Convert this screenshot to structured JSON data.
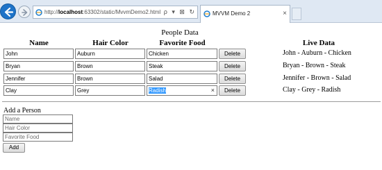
{
  "browser": {
    "url_prefix": "http://",
    "url_host": "localhost",
    "url_rest": ":63302/static/MvvmDemo2.html",
    "address_buttons": "ρ ▾ ⊠ ↻",
    "tab_title": "MVVM Demo 2",
    "tab_close": "×"
  },
  "page": {
    "title": "People Data",
    "headers": {
      "name": "Name",
      "hair": "Hair Color",
      "food": "Favorite Food",
      "live": "Live Data"
    },
    "rows": [
      {
        "name": "John",
        "hair": "Auburn",
        "food": "Chicken",
        "delete": "Delete",
        "live": "John - Auburn - Chicken"
      },
      {
        "name": "Bryan",
        "hair": "Brown",
        "food": "Steak",
        "delete": "Delete",
        "live": "Bryan - Brown - Steak"
      },
      {
        "name": "Jennifer",
        "hair": "Brown",
        "food": "Salad",
        "delete": "Delete",
        "live": "Jennifer - Brown - Salad"
      },
      {
        "name": "Clay",
        "hair": "Grey",
        "food": "Radish",
        "delete": "Delete",
        "live": "Clay - Grey - Radish"
      }
    ],
    "clear_glyph": "×",
    "add_person": {
      "title": "Add a Person",
      "name_placeholder": "Name",
      "hair_placeholder": "Hair Color",
      "food_placeholder": "Favorite Food",
      "add_label": "Add"
    }
  }
}
